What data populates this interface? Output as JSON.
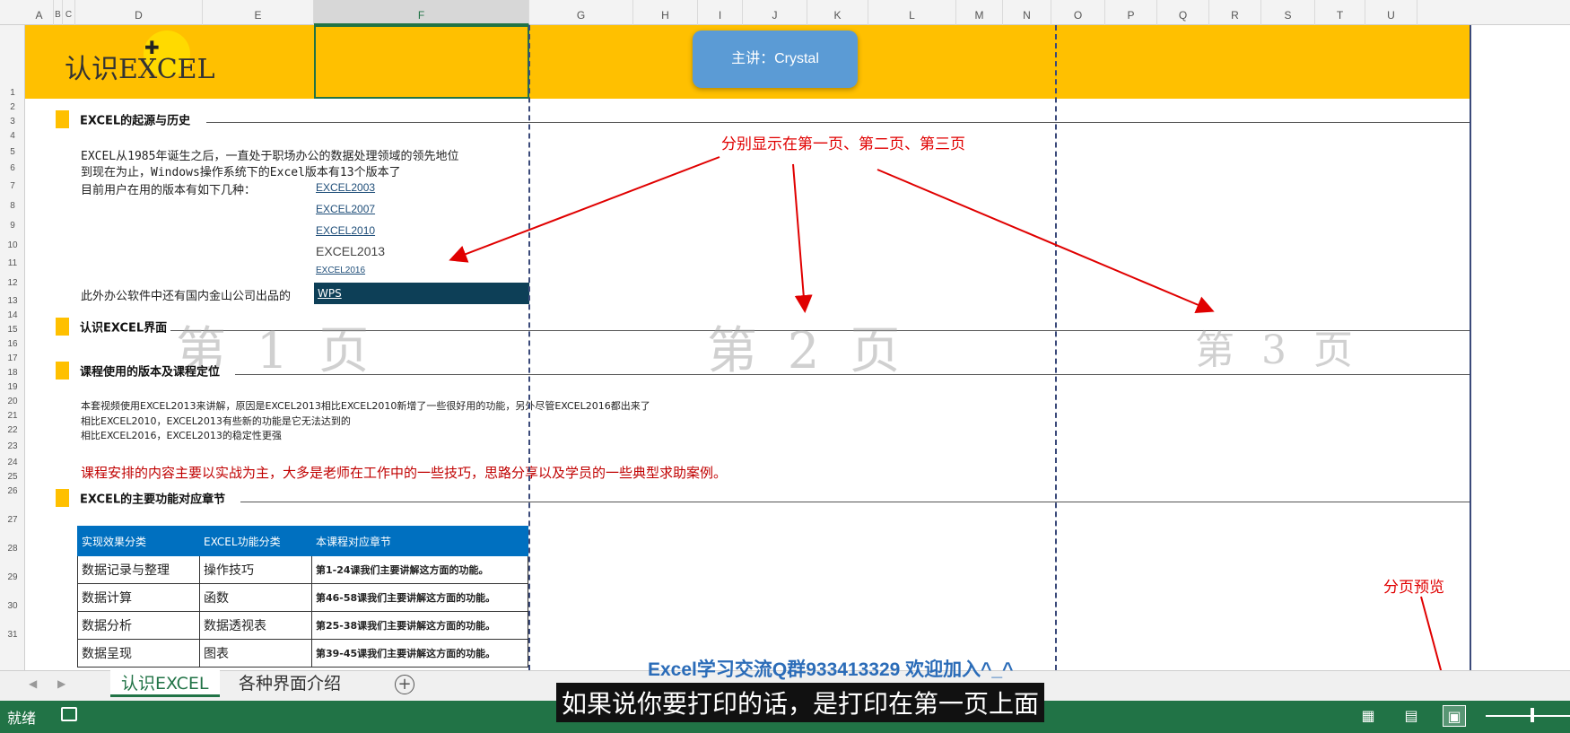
{
  "columns": [
    "A",
    "B",
    "C",
    "D",
    "E",
    "F",
    "G",
    "H",
    "I",
    "J",
    "K",
    "L",
    "M",
    "N",
    "O",
    "P",
    "Q",
    "R",
    "S",
    "T",
    "U"
  ],
  "rows": [
    "1",
    "2",
    "3",
    "4",
    "5",
    "6",
    "7",
    "8",
    "9",
    "10",
    "11",
    "12",
    "13",
    "14",
    "15",
    "16",
    "17",
    "18",
    "19",
    "20",
    "21",
    "22",
    "23",
    "24",
    "25",
    "26",
    "27",
    "28",
    "29",
    "30",
    "31"
  ],
  "header": {
    "title": "认识EXCEL",
    "lecturer": "主讲：Crystal"
  },
  "sections": {
    "s1": "EXCEL的起源与历史",
    "s2": "认识EXCEL界面",
    "s3": "课程使用的版本及课程定位",
    "s4": "EXCEL的主要功能对应章节"
  },
  "history": {
    "line1": "EXCEL从1985年诞生之后，一直处于职场办公的数据处理领域的领先地位",
    "line2": "到现在为止，Windows操作系统下的Excel版本有13个版本了",
    "line3": "目前用户在用的版本有如下几种：",
    "wps_line": "此外办公软件中还有国内金山公司出品的"
  },
  "versions": [
    "EXCEL2003",
    "EXCEL2007",
    "EXCEL2010",
    "EXCEL2013",
    "EXCEL2016"
  ],
  "wps": "WPS",
  "pages": {
    "p1": "第 1 页",
    "p2": "第 2 页",
    "p3": "第 3 页"
  },
  "course": {
    "line1": "本套视频使用EXCEL2013来讲解，原因是EXCEL2013相比EXCEL2010新增了一些很好用的功能，另外尽管EXCEL2016都出来了",
    "line2": "相比EXCEL2010，EXCEL2013有些新的功能是它无法达到的",
    "line3": "相比EXCEL2016，EXCEL2013的稳定性更强",
    "note": "课程安排的内容主要以实战为主，大多是老师在工作中的一些技巧，思路分享以及学员的一些典型求助案例。"
  },
  "table": {
    "headers": [
      "实现效果分类",
      "EXCEL功能分类",
      "本课程对应章节"
    ],
    "rows": [
      [
        "数据记录与整理",
        "操作技巧",
        "第1-24课我们主要讲解这方面的功能。"
      ],
      [
        "数据计算",
        "函数",
        "第46-58课我们主要讲解这方面的功能。"
      ],
      [
        "数据分析",
        "数据透视表",
        "第25-38课我们主要讲解这方面的功能。"
      ],
      [
        "数据呈现",
        "图表",
        "第39-45课我们主要讲解这方面的功能。"
      ]
    ]
  },
  "annotations": {
    "pages_note": "分别显示在第一页、第二页、第三页",
    "preview_note": "分页预览"
  },
  "overlay": {
    "qq": "Excel学习交流Q群933413329 欢迎加入^_^",
    "subtitle": "如果说你要打印的话，是打印在第一页上面"
  },
  "tabs": [
    "认识EXCEL",
    "各种界面介绍"
  ],
  "add_sheet": "+",
  "status": {
    "ready": "就绪"
  },
  "nav": {
    "prev": "◀",
    "next": "▶"
  },
  "colors": {
    "banner": "#ffc000",
    "excel_green": "#217346",
    "table_header": "#0070c0",
    "annotation_red": "#e00000"
  }
}
